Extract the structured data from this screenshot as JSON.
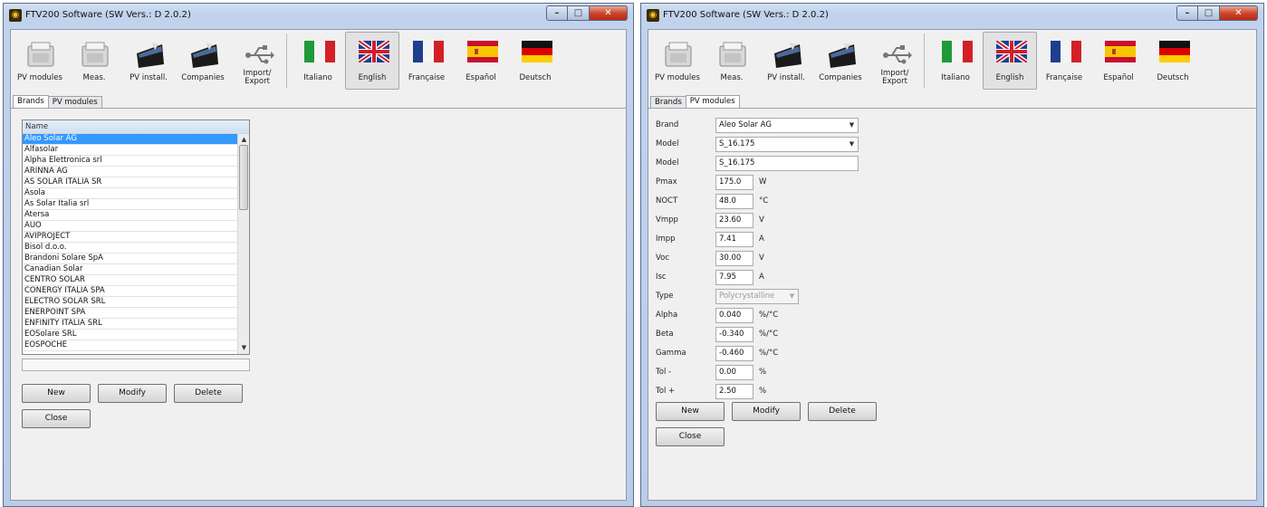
{
  "left_window": {
    "title": "FTV200 Software (SW Vers.: D 2.0.2)",
    "toolbar": {
      "pv_modules": "PV modules",
      "meas": "Meas.",
      "pv_install": "PV install.",
      "companies": "Companies",
      "import_export": "Import/\nExport",
      "italiano": "Italiano",
      "english": "English",
      "francaise": "Française",
      "espanol": "Español",
      "deutsch": "Deutsch"
    },
    "tabs": [
      "Brands",
      "PV modules"
    ],
    "active_tab": "Brands",
    "grid": {
      "header": "Name",
      "rows": [
        "Aleo Solar AG",
        "Alfasolar",
        "Alpha Elettronica srl",
        "ARINNA AG",
        "AS SOLAR ITALIA SR",
        "Asola",
        "As Solar Italia srl",
        "Atersa",
        "AUO",
        "AVIPROJECT",
        "Bisol d.o.o.",
        "Brandoni Solare SpA",
        "Canadian Solar",
        "CENTRO SOLAR",
        "CONERGY ITALIA SPA",
        "ELECTRO SOLAR SRL",
        "ENERPOINT SPA",
        "ENFINITY ITALIA SRL",
        "EOSolare SRL",
        "EOSPOCHE"
      ],
      "selected_index": 0
    },
    "buttons": {
      "new": "New",
      "modify": "Modify",
      "delete": "Delete",
      "close": "Close"
    }
  },
  "right_window": {
    "title": "FTV200 Software (SW Vers.: D 2.0.2)",
    "toolbar": {
      "pv_modules": "PV modules",
      "meas": "Meas.",
      "pv_install": "PV install.",
      "companies": "Companies",
      "import_export": "Import/\nExport",
      "italiano": "Italiano",
      "english": "English",
      "francaise": "Française",
      "espanol": "Español",
      "deutsch": "Deutsch"
    },
    "tabs": [
      "Brands",
      "PV modules"
    ],
    "active_tab": "PV modules",
    "form": {
      "brand": {
        "label": "Brand",
        "value": "Aleo Solar AG"
      },
      "model_select": {
        "label": "Model",
        "value": "S_16.175"
      },
      "model_text": {
        "label": "Model",
        "value": "S_16.175"
      },
      "pmax": {
        "label": "Pmax",
        "value": "175.0",
        "unit": "W"
      },
      "noct": {
        "label": "NOCT",
        "value": "48.0",
        "unit": "°C"
      },
      "vmpp": {
        "label": "Vmpp",
        "value": "23.60",
        "unit": "V"
      },
      "impp": {
        "label": "Impp",
        "value": "7.41",
        "unit": "A"
      },
      "voc": {
        "label": "Voc",
        "value": "30.00",
        "unit": "V"
      },
      "isc": {
        "label": "Isc",
        "value": "7.95",
        "unit": "A"
      },
      "type": {
        "label": "Type",
        "value": "Polycrystalline"
      },
      "alpha": {
        "label": "Alpha",
        "value": "0.040",
        "unit": "%/°C"
      },
      "beta": {
        "label": "Beta",
        "value": "-0.340",
        "unit": "%/°C"
      },
      "gamma": {
        "label": "Gamma",
        "value": "-0.460",
        "unit": "%/°C"
      },
      "tol_minus": {
        "label": "Tol -",
        "value": "0.00",
        "unit": "%"
      },
      "tol_plus": {
        "label": "Tol +",
        "value": "2.50",
        "unit": "%"
      }
    },
    "buttons": {
      "new": "New",
      "modify": "Modify",
      "delete": "Delete",
      "close": "Close"
    }
  },
  "colors": {
    "selection": "#3399ff",
    "close_button": "#c94227",
    "window_frame": "#c1d3ec"
  }
}
